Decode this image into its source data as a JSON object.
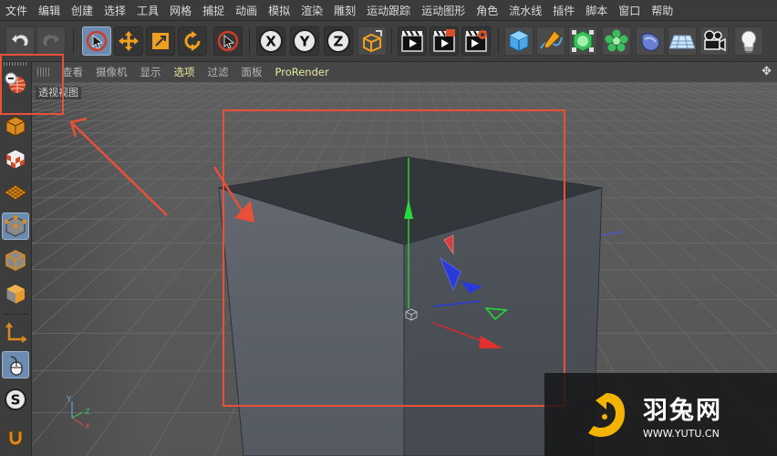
{
  "colors": {
    "accent": "#6c8bb0",
    "highlight": "#e8503a",
    "active_text": "#e8e8a0",
    "watermark_logo": "#f2b400"
  },
  "menubar": {
    "items": [
      "文件",
      "编辑",
      "创建",
      "选择",
      "工具",
      "网格",
      "捕捉",
      "动画",
      "模拟",
      "渲染",
      "雕刻",
      "运动跟踪",
      "运动图形",
      "角色",
      "流水线",
      "插件",
      "脚本",
      "窗口",
      "帮助"
    ]
  },
  "toolbar": {
    "icons": [
      "undo-icon",
      "redo-icon",
      "live-selection-icon",
      "move-icon",
      "scale-icon",
      "rotate-icon",
      "recent-tool-icon",
      "x-axis-icon",
      "y-axis-icon",
      "z-axis-icon",
      "world-coordinate-icon",
      "render-view-icon",
      "render-picture-viewer-icon",
      "edit-render-settings-icon",
      "cube-icon",
      "pen-icon",
      "subdivision-icon",
      "cloner-icon",
      "deformer-icon",
      "floor-icon",
      "camera-icon",
      "light-icon"
    ],
    "axis_labels": {
      "x": "X",
      "y": "Y",
      "z": "Z"
    }
  },
  "leftbar": {
    "icons": [
      "make-editable-icon",
      "model-mode-icon",
      "texture-mode-icon",
      "workplane-icon",
      "points-mode-icon",
      "edges-mode-icon",
      "polygons-mode-icon",
      "axis-mode-icon",
      "tweak-mode-icon",
      "snap-icon",
      "magnet-icon"
    ],
    "snap_label": "S"
  },
  "viewport": {
    "menu": [
      "查看",
      "摄像机",
      "显示",
      "选项",
      "过滤",
      "面板",
      "ProRender"
    ],
    "active_menu": "选项",
    "label": "透视视图",
    "axis_gizmo": {
      "x": "X",
      "y": "Y",
      "z": "Z"
    }
  },
  "watermark": {
    "name": "羽兔网",
    "url": "WWW.YUTU.CN"
  }
}
